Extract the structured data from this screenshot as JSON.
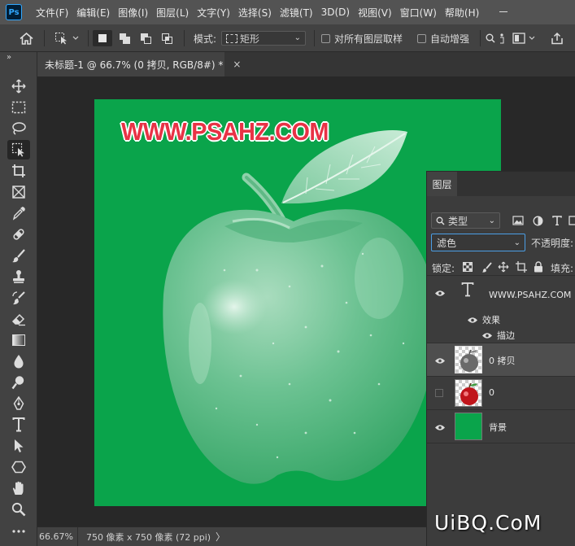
{
  "app": {
    "logo_text": "Ps"
  },
  "menu": [
    "文件(F)",
    "编辑(E)",
    "图像(I)",
    "图层(L)",
    "文字(Y)",
    "选择(S)",
    "滤镜(T)",
    "3D(D)",
    "视图(V)",
    "窗口(W)",
    "帮助(H)"
  ],
  "options_bar": {
    "mode_label": "模式:",
    "mode_value": "矩形",
    "sample_all_layers": "对所有图层取样",
    "auto_enhance": "自动增强"
  },
  "toolbar": {
    "collapse": "»",
    "tools": [
      "move-tool",
      "rectangular-marquee-tool",
      "lasso-tool",
      "object-selection-tool",
      "crop-tool",
      "frame-tool",
      "eyedropper-tool",
      "healing-brush-tool",
      "brush-tool",
      "clone-stamp-tool",
      "history-brush-tool",
      "eraser-tool",
      "gradient-tool",
      "blur-tool",
      "dodge-tool",
      "pen-tool",
      "type-tool",
      "path-selection-tool",
      "shape-tool",
      "hand-tool",
      "zoom-tool",
      "more-tools"
    ],
    "active_tool": "object-selection-tool"
  },
  "document_tab": {
    "title": "未标题-1 @ 66.7% (0 拷贝, RGB/8#) *",
    "close": "×"
  },
  "canvas": {
    "background_color": "#0aa44b",
    "watermark_text": "WWW.PSAHZ.COM",
    "watermark_color": "#e83245"
  },
  "status_bar": {
    "zoom": "66.67%",
    "info": "750 像素 x 750 像素 (72 ppi)",
    "arrow": "〉"
  },
  "layers_panel": {
    "tab": "图层",
    "kind_filter": "类型",
    "blend_mode": "滤色",
    "opacity_label": "不透明度:",
    "lock_label": "锁定:",
    "fill_label": "填充:",
    "layers": [
      {
        "name": "WWW.PSAHZ.COM",
        "type": "text",
        "visible": true,
        "effects_label": "效果",
        "effect": "描边"
      },
      {
        "name": "0 拷贝",
        "type": "image",
        "visible": true,
        "selected": true
      },
      {
        "name": "0",
        "type": "image",
        "visible": false
      },
      {
        "name": "背景",
        "type": "fill",
        "visible": true,
        "color": "#0aa44b"
      }
    ]
  },
  "site_watermark": "UiBQ.CoM"
}
